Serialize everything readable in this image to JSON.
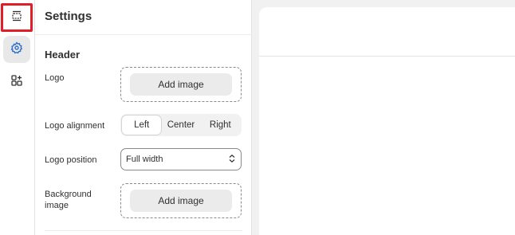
{
  "rail": {
    "items": [
      {
        "icon": "sections-icon",
        "active": false,
        "highlighted": true
      },
      {
        "icon": "gear-icon",
        "active": true
      },
      {
        "icon": "apps-icon",
        "active": false
      }
    ],
    "highlight_color": "#e11d27"
  },
  "panel": {
    "title": "Settings",
    "section_title": "Header",
    "logo": {
      "label": "Logo",
      "button_label": "Add image"
    },
    "logo_alignment": {
      "label": "Logo alignment",
      "options": [
        "Left",
        "Center",
        "Right"
      ],
      "selected": "Left"
    },
    "logo_position": {
      "label": "Logo position",
      "value": "Full width"
    },
    "background_image": {
      "label_line1": "Background",
      "label_line2": "image",
      "button_label": "Add image"
    }
  }
}
